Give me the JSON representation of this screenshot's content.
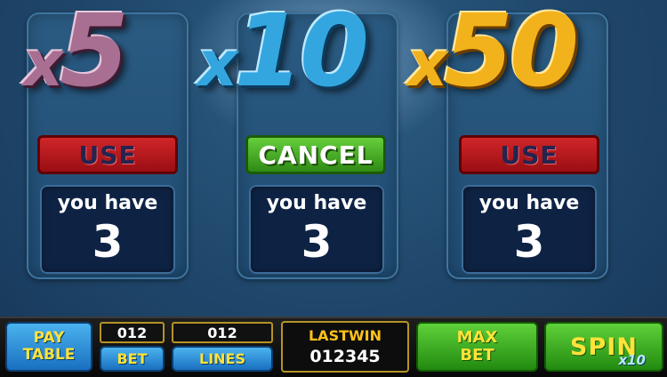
{
  "colors": {
    "use_red": "#c0181c",
    "cancel_green": "#3ca81f",
    "x5_color": "#a86f93",
    "x10_color": "#33a6e0",
    "x50_color": "#f2b21b",
    "label_yellow": "#ffe23a"
  },
  "boosters": [
    {
      "x": "x",
      "n": "5",
      "button": "USE",
      "have_label": "you have",
      "count": "3"
    },
    {
      "x": "x",
      "n": "10",
      "button": "CANCEL",
      "have_label": "you have",
      "count": "3"
    },
    {
      "x": "x",
      "n": "50",
      "button": "USE",
      "have_label": "you have",
      "count": "3"
    }
  ],
  "bottom": {
    "paytable_line1": "PAY",
    "paytable_line2": "TABLE",
    "bet_value": "012",
    "bet_label": "BET",
    "lines_value": "012",
    "lines_label": "LINES",
    "lastwin_label": "LASTWIN",
    "lastwin_value": "012345",
    "maxbet_line1": "MAX",
    "maxbet_line2": "BET",
    "spin_label": "SPIN",
    "spin_multiplier": "x10"
  }
}
